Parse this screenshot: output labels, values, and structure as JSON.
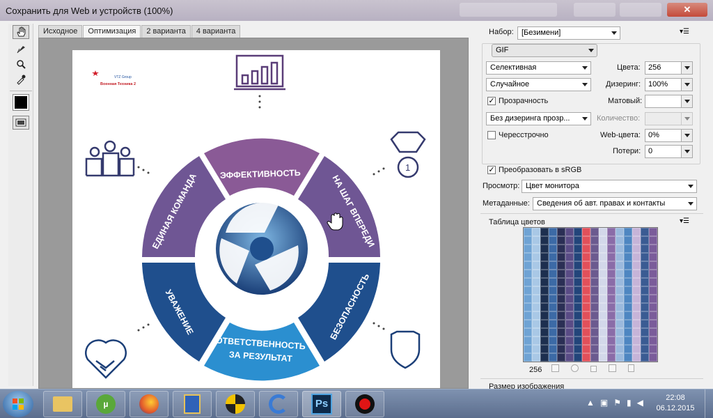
{
  "window": {
    "title": "Сохранить для Web и устройств (100%)"
  },
  "tabs": [
    "Исходное",
    "Оптимизация",
    "2 варианта",
    "4 варианта"
  ],
  "artwork": {
    "logo_line1": "VTZ Group",
    "logo_line2": "Военная Техника 2",
    "segments": {
      "top": "ЭФФЕКТИВНОСТЬ",
      "right_top": "НА ШАГ ВПЕРЕДИ",
      "right_bottom": "БЕЗОПАСНОСТЬ",
      "bottom_l1": "ОТВЕТСТВЕННОСТЬ",
      "bottom_l2": "ЗА РЕЗУЛЬТАТ",
      "left_bottom": "УВАЖЕНИЕ",
      "left_top": "ЕДИНАЯ КОМАНДА"
    },
    "medal_number": "1"
  },
  "panel": {
    "preset_label": "Набор:",
    "preset_value": "[Безимени]",
    "format": "GIF",
    "reduction": "Селективная",
    "colors_label": "Цвета:",
    "colors_value": "256",
    "dither_method": "Случайное",
    "dither_label": "Дизеринг:",
    "dither_value": "100%",
    "transparency_label": "Прозрачность",
    "matte_label": "Матовый:",
    "transp_dither": "Без дизеринга прозр...",
    "amount_label": "Количество:",
    "interlaced_label": "Чересстрочно",
    "websnap_label": "Web-цвета:",
    "websnap_value": "0%",
    "lossy_label": "Потери:",
    "lossy_value": "0",
    "srgb_label": "Преобразовать в sRGB",
    "preview_label": "Просмотр:",
    "preview_value": "Цвет монитора",
    "metadata_label": "Метаданные:",
    "metadata_value": "Сведения об авт. правах и контакты",
    "color_table_label": "Таблица цветов",
    "color_count": "256",
    "image_size_label": "Размер изображения"
  },
  "colors": {
    "purple": "#8a5a96",
    "blue_dark": "#1c4f8c",
    "blue_mid": "#2e77b8",
    "blue_light": "#3a9ad0",
    "panel_bg": "#f0f0f0"
  },
  "taskbar": {
    "time": "22:08",
    "date": "06.12.2015",
    "apps": [
      "explorer",
      "utorrent",
      "firefox",
      "notepad",
      "media",
      "ccleaner",
      "photoshop",
      "recorder"
    ],
    "ps_label": "Ps"
  }
}
